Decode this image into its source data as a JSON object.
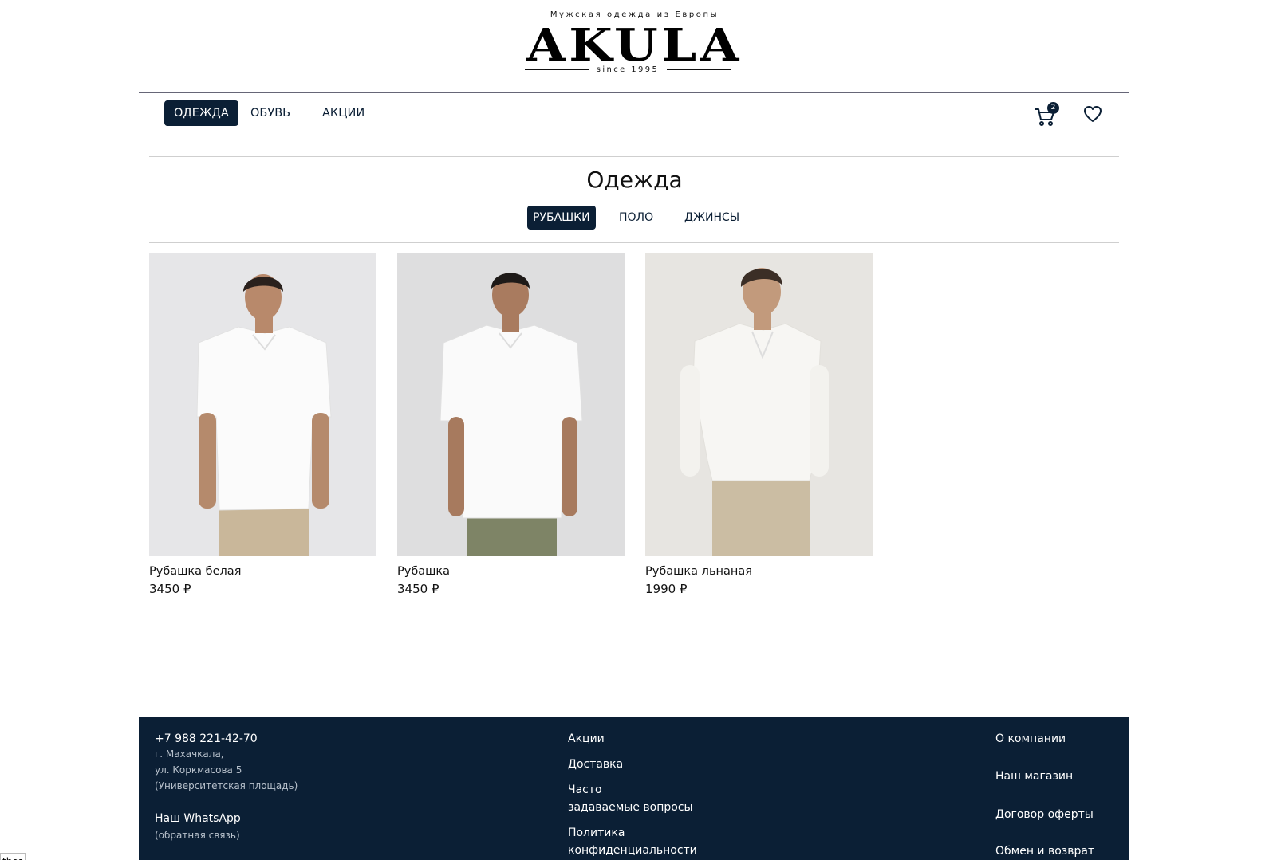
{
  "header": {
    "tagline": "Мужская одежда из Европы",
    "brand": "AKULA",
    "since": "since 1995"
  },
  "nav": {
    "items": [
      {
        "label": "ОДЕЖДА",
        "active": true
      },
      {
        "label": "ОБУВЬ",
        "active": false
      },
      {
        "label": "АКЦИИ",
        "active": false
      }
    ],
    "cart_count": "2",
    "cart_icon": "cart-icon",
    "favorites_icon": "heart-icon"
  },
  "section": {
    "title": "Одежда",
    "subtabs": [
      {
        "label": "РУБАШКИ",
        "active": true
      },
      {
        "label": "ПОЛО",
        "active": false
      },
      {
        "label": "ДЖИНСЫ",
        "active": false
      }
    ]
  },
  "products": [
    {
      "name": "Рубашка белая",
      "price": "3450 ₽",
      "pants_color": "#c9b79a",
      "bg": "#e6e6e8"
    },
    {
      "name": "Рубашка",
      "price": "3450 ₽",
      "pants_color": "#7e8466",
      "bg": "#dededf"
    },
    {
      "name": "Рубашка льнаная",
      "price": "1990 ₽",
      "pants_color": "#cbbda3",
      "bg": "#e7e5e1"
    }
  ],
  "footer": {
    "phone": "+7 988 221-42-70",
    "city": "г. Махачкала,",
    "street": "ул. Коркмасова 5",
    "landmark": "(Университетская площадь)",
    "whatsapp": "Наш WhatsApp",
    "whatsapp_note": "(обратная связь)",
    "col2": [
      "Акции",
      "Доставка",
      "Часто",
      "задаваемые вопросы",
      "Политика",
      "конфиденциальности"
    ],
    "col3": [
      "О компании",
      "Наш магазин",
      "Договор оферты",
      "Обмен и возврат"
    ]
  },
  "corner_tip": "thes",
  "colors": {
    "brand_navy": "#0b1f35"
  }
}
